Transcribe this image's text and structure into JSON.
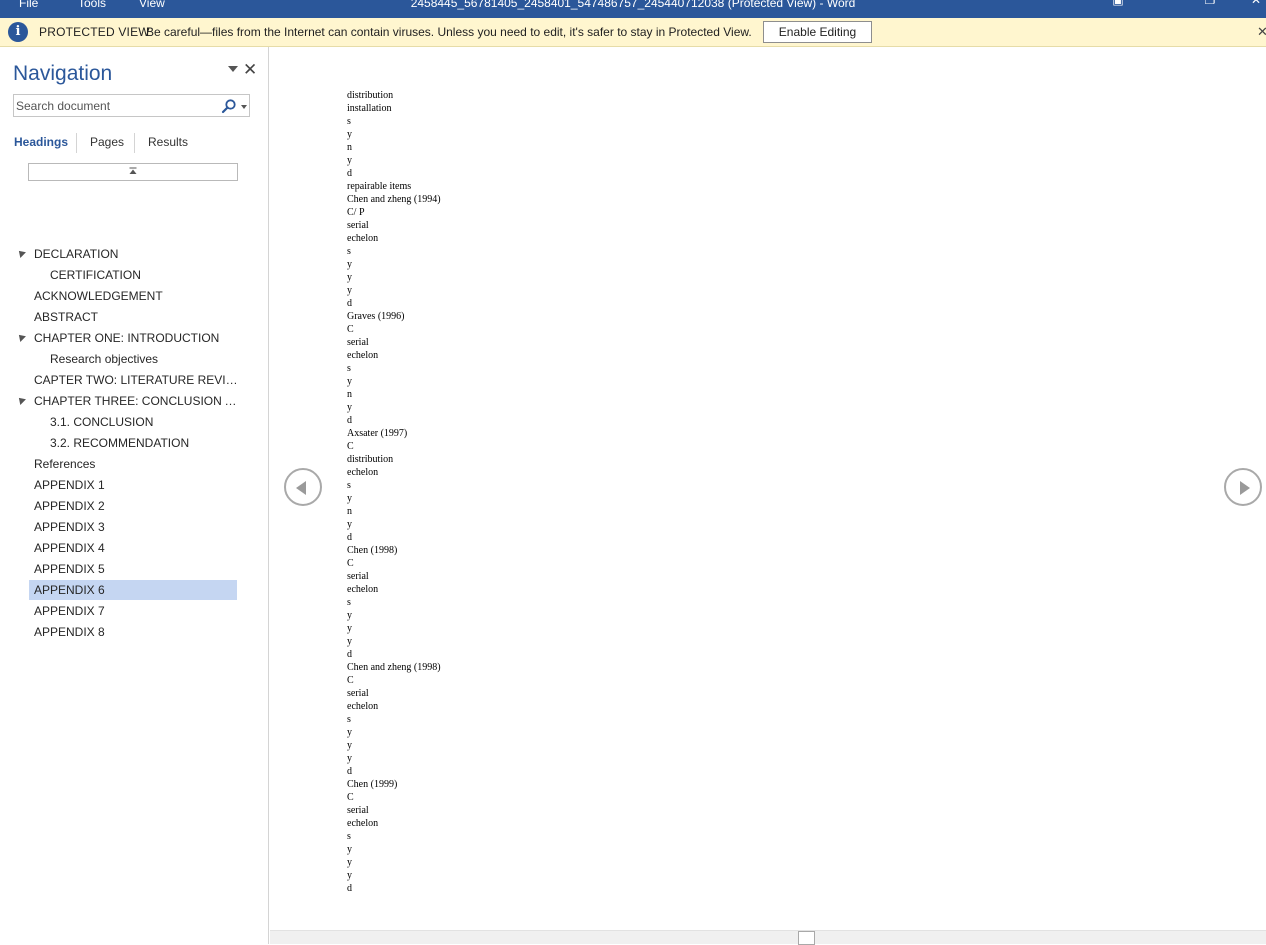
{
  "titlebar": {
    "menu": [
      "File",
      "Tools",
      "View"
    ],
    "title": "2458445_56781405_2458401_547486757_245440712038 (Protected View) - Word",
    "bg_color": "#2b579a"
  },
  "protected_view": {
    "label": "PROTECTED VIEW",
    "message": "Be careful—files from the Internet can contain viruses. Unless you need to edit, it's safer to stay in Protected View.",
    "enable_button": "Enable Editing",
    "close_icon": "close-icon",
    "bg_color": "#fff6cf"
  },
  "navigation": {
    "title": "Navigation",
    "search_placeholder": "Search document",
    "tabs": [
      "Headings",
      "Pages",
      "Results"
    ],
    "active_tab": "Headings",
    "headings": [
      {
        "text": "DECLARATION",
        "level": 1,
        "expander": true,
        "selected": false
      },
      {
        "text": "CERTIFICATION",
        "level": 2,
        "expander": false,
        "selected": false
      },
      {
        "text": "ACKNOWLEDGEMENT",
        "level": 1,
        "expander": false,
        "selected": false
      },
      {
        "text": "ABSTRACT",
        "level": 1,
        "expander": false,
        "selected": false
      },
      {
        "text": "CHAPTER ONE: INTRODUCTION",
        "level": 1,
        "expander": true,
        "selected": false
      },
      {
        "text": "Research objectives",
        "level": 2,
        "expander": false,
        "selected": false
      },
      {
        "text": "CAPTER TWO: LITERATURE REVIEW",
        "level": 1,
        "expander": false,
        "selected": false
      },
      {
        "text": "CHAPTER THREE: CONCLUSION AN...",
        "level": 1,
        "expander": true,
        "selected": false
      },
      {
        "text": "3.1. CONCLUSION",
        "level": 2,
        "expander": false,
        "selected": false
      },
      {
        "text": "3.2. RECOMMENDATION",
        "level": 2,
        "expander": false,
        "selected": false
      },
      {
        "text": "References",
        "level": 1,
        "expander": false,
        "selected": false
      },
      {
        "text": "APPENDIX 1",
        "level": 1,
        "expander": false,
        "selected": false
      },
      {
        "text": "APPENDIX 2",
        "level": 1,
        "expander": false,
        "selected": false
      },
      {
        "text": "APPENDIX 3",
        "level": 1,
        "expander": false,
        "selected": false
      },
      {
        "text": "APPENDIX 4",
        "level": 1,
        "expander": false,
        "selected": false
      },
      {
        "text": "APPENDIX 5",
        "level": 1,
        "expander": false,
        "selected": false
      },
      {
        "text": "APPENDIX 6",
        "level": 1,
        "expander": false,
        "selected": true
      },
      {
        "text": "APPENDIX 7",
        "level": 1,
        "expander": false,
        "selected": false
      },
      {
        "text": "APPENDIX 8",
        "level": 1,
        "expander": false,
        "selected": false
      }
    ],
    "accent_color": "#2b579a",
    "selected_color": "#c5d6f2"
  },
  "document": {
    "lines": [
      "distribution",
      "installation",
      "s",
      "y",
      "n",
      "y",
      "d",
      "repairable items",
      "Chen and zheng (1994)",
      "C/ P",
      "serial",
      "echelon",
      "s",
      "y",
      "y",
      "y",
      "d",
      "Graves (1996)",
      "C",
      "serial",
      "echelon",
      "s",
      "y",
      "n",
      "y",
      "d",
      "Axsater (1997)",
      "C",
      "distribution",
      "echelon",
      "s",
      "y",
      "n",
      "y",
      "d",
      "Chen (1998)",
      "C",
      "serial",
      "echelon",
      "s",
      "y",
      "y",
      "y",
      "d",
      "Chen and zheng (1998)",
      "C",
      "serial",
      "echelon",
      "s",
      "y",
      "y",
      "y",
      "d",
      "Chen (1999)",
      "C",
      "serial",
      "echelon",
      "s",
      "y",
      "y",
      "y",
      "d"
    ]
  }
}
